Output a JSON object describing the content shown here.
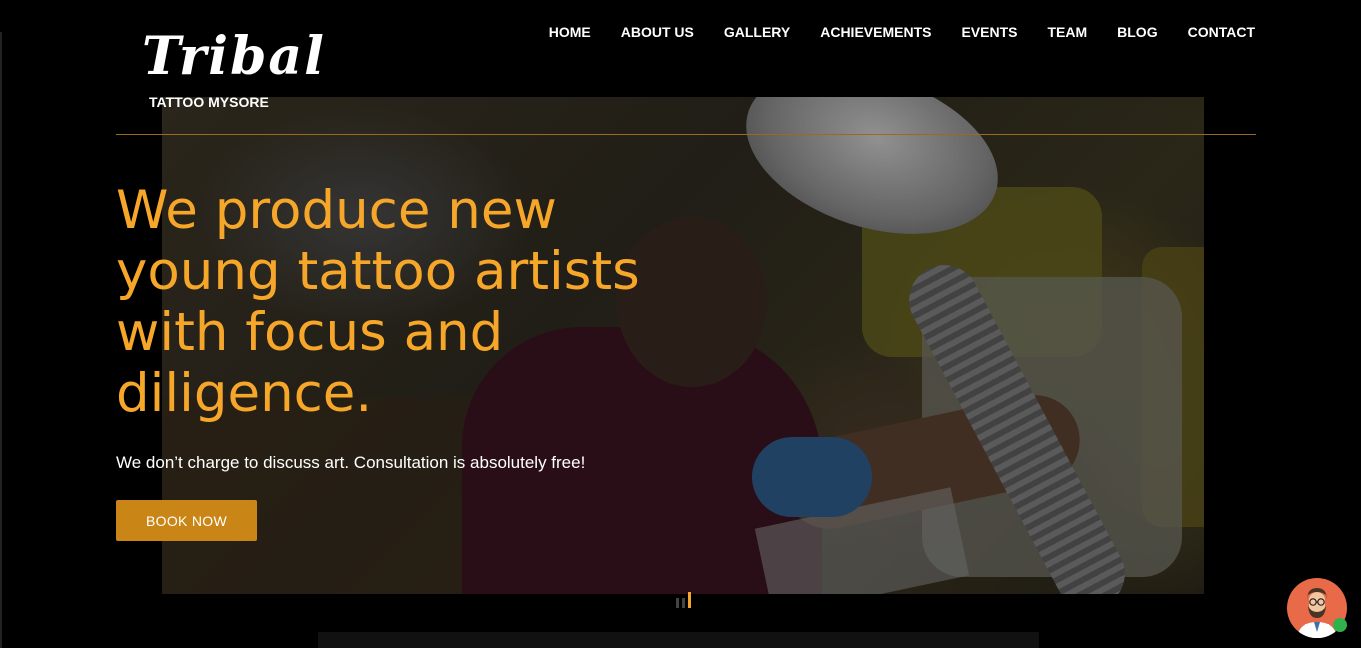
{
  "header": {
    "logo_script": "Tribal",
    "logo_sub": "TATTOO MYSORE",
    "nav": [
      {
        "label": "HOME"
      },
      {
        "label": "ABOUT US"
      },
      {
        "label": "GALLERY"
      },
      {
        "label": "ACHIEVEMENTS"
      },
      {
        "label": "EVENTS"
      },
      {
        "label": "TEAM"
      },
      {
        "label": "BLOG"
      },
      {
        "label": "CONTACT"
      }
    ]
  },
  "hero": {
    "headline": "We produce new young tattoo artists with focus and diligence.",
    "subline": "We don’t charge to discuss art. Consultation is absolutely free!",
    "cta_label": "BOOK NOW",
    "slide_count": 3,
    "active_slide": 3
  },
  "chat": {
    "icon": "support-agent-icon",
    "status_icon": "online-status-icon"
  },
  "colors": {
    "accent": "#f6a72a",
    "button": "#c98616",
    "background": "#000000",
    "online": "#2fb24c",
    "avatar_bg": "#e86a48"
  }
}
